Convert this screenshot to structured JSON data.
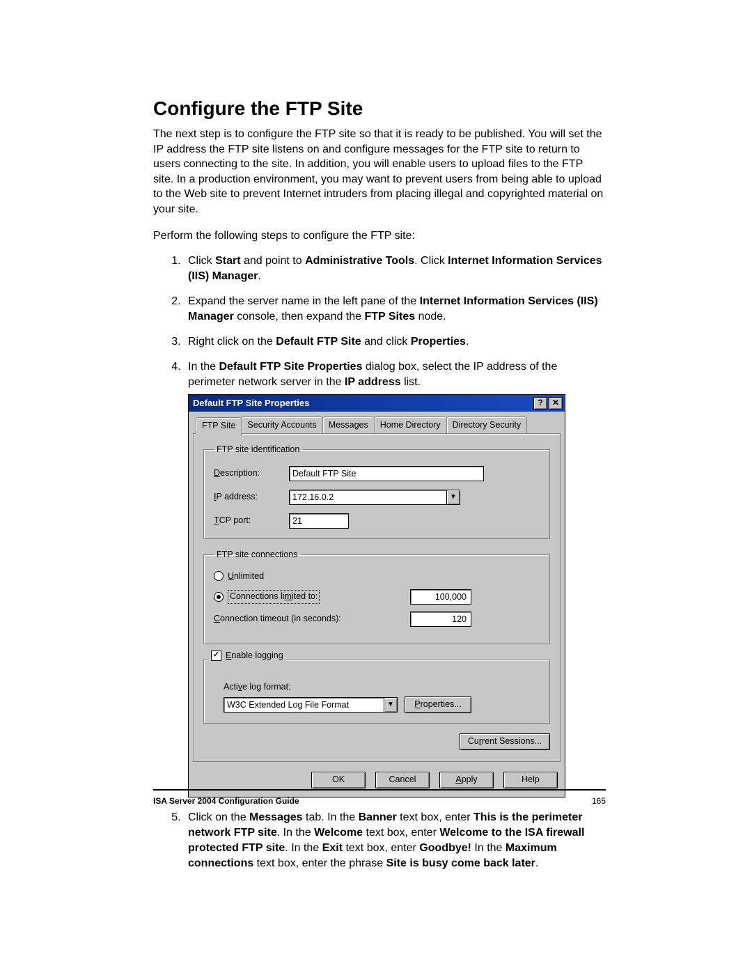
{
  "heading": "Configure the FTP Site",
  "intro": "The next step is to configure the FTP site so that it is ready to be published. You will set the IP address the FTP site listens on and configure messages for the FTP site to return to users connecting to the site. In addition, you will enable users to upload files to the FTP site. In a production environment, you may want to prevent users from being able to upload to the Web site to prevent Internet intruders from placing illegal and copyrighted material on your site.",
  "lead": "Perform the following steps to configure the FTP site:",
  "steps": {
    "s1_a": "Click ",
    "s1_b": "Start",
    "s1_c": " and point to ",
    "s1_d": "Administrative Tools",
    "s1_e": ". Click ",
    "s1_f": "Internet Information Services (IIS) Manager",
    "s1_g": ".",
    "s2_a": "Expand the server name in the left pane of the ",
    "s2_b": "Internet Information Services (IIS) Manager",
    "s2_c": " console, then expand the ",
    "s2_d": "FTP Sites",
    "s2_e": " node.",
    "s3_a": "Right click on the ",
    "s3_b": "Default FTP Site",
    "s3_c": " and click ",
    "s3_d": "Properties",
    "s3_e": ".",
    "s4_a": "In the ",
    "s4_b": "Default FTP Site Properties",
    "s4_c": " dialog box, select the IP address of the perimeter network server in the ",
    "s4_d": "IP address",
    "s4_e": " list.",
    "s5_a": "Click on the ",
    "s5_b": "Messages",
    "s5_c": " tab. In the ",
    "s5_d": "Banner",
    "s5_e": " text box, enter ",
    "s5_f": "This is the perimeter network FTP site",
    "s5_g": ". In the ",
    "s5_h": "Welcome",
    "s5_i": " text box, enter ",
    "s5_j": "Welcome to the ISA firewall protected FTP site",
    "s5_k": ". In the ",
    "s5_l": "Exit",
    "s5_m": " text box, enter ",
    "s5_n": "Goodbye!",
    "s5_o": " In the ",
    "s5_p": "Maximum connections",
    "s5_q": " text box, enter the phrase ",
    "s5_r": "Site is busy come back later",
    "s5_s": "."
  },
  "dialog": {
    "title": "Default FTP Site Properties",
    "help_btn": "?",
    "close_btn": "✕",
    "tabs": {
      "t0": "FTP Site",
      "t1": "Security Accounts",
      "t2": "Messages",
      "t3": "Home Directory",
      "t4": "Directory Security"
    },
    "group_ident": "FTP site identification",
    "label_desc_pre": "D",
    "label_desc_post": "escription:",
    "value_desc": "Default FTP Site",
    "label_ip_pre": "I",
    "label_ip_post": "P address:",
    "value_ip": "172.16.0.2",
    "label_tcp_pre": "T",
    "label_tcp_post": "CP port:",
    "value_tcp": "21",
    "group_conn": "FTP site connections",
    "radio_unlimited_pre": "U",
    "radio_unlimited_post": "nlimited",
    "radio_limited_a": "Connections li",
    "radio_limited_u": "m",
    "radio_limited_b": "ited to:",
    "value_conn_limit": "100,000",
    "label_timeout_a": "C",
    "label_timeout_b": "onnection timeout (in seconds):",
    "value_timeout": "120",
    "check_logging_pre": "E",
    "check_logging_post": "nable logging",
    "label_log_format_a": "Acti",
    "label_log_format_u": "v",
    "label_log_format_b": "e log format:",
    "value_log_format": "W3C Extended Log File Format",
    "btn_properties_pre": "P",
    "btn_properties_post": "roperties...",
    "btn_current_pre": "Cu",
    "btn_current_u": "r",
    "btn_current_post": "rent Sessions...",
    "btn_ok": "OK",
    "btn_cancel": "Cancel",
    "btn_apply_pre": "A",
    "btn_apply_post": "pply",
    "btn_help": "Help"
  },
  "footer": {
    "title": "ISA Server 2004 Configuration Guide",
    "page": "165"
  }
}
